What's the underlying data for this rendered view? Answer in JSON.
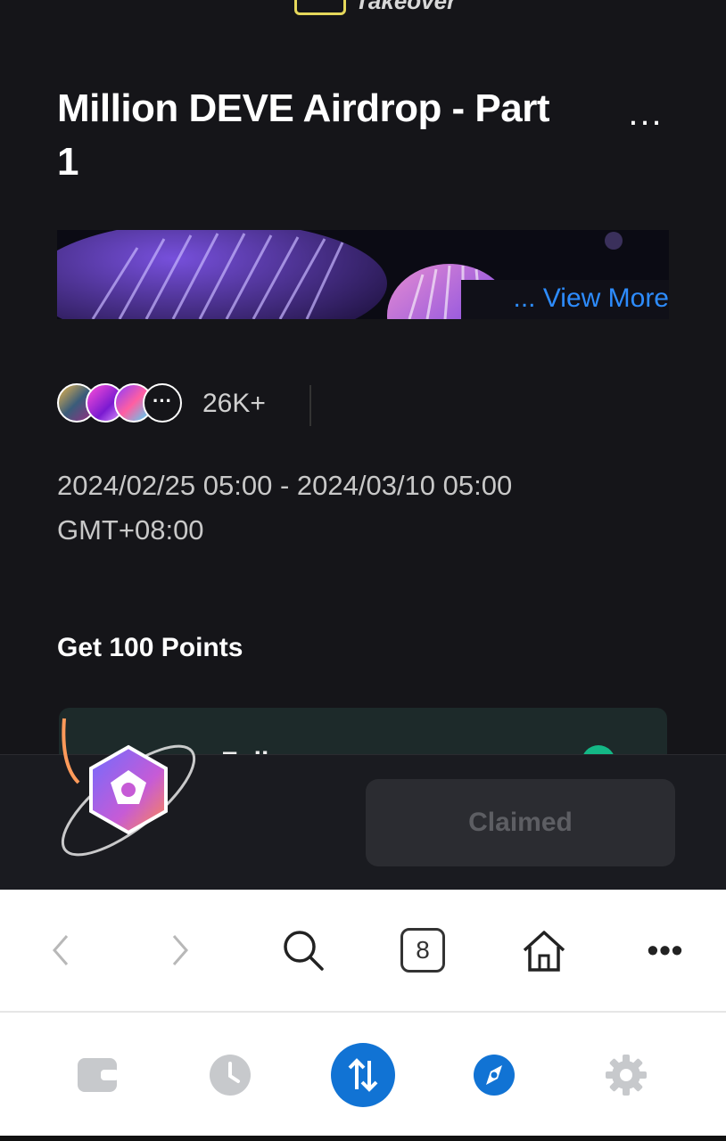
{
  "header": {
    "logo_text": "Takeover"
  },
  "campaign": {
    "title": "Million DEVE Airdrop - Part 1",
    "more_label": "...",
    "view_more": "... View More",
    "participants": "26K+",
    "avatar_more": "···",
    "date_range": "2024/02/25 05:00 - 2024/03/10 05:00",
    "timezone": "GMT+08:00"
  },
  "task_section": {
    "heading": "Get 100 Points",
    "task_label": "Foll"
  },
  "claim": {
    "button_label": "Claimed"
  },
  "browser_toolbar": {
    "tab_count": "8",
    "icons": [
      "back-icon",
      "forward-icon",
      "search-icon",
      "tabs-icon",
      "home-icon",
      "more-icon"
    ],
    "more_label": "•••"
  },
  "bottom_nav": {
    "icons": [
      "wallet-icon",
      "history-icon",
      "swap-icon",
      "discover-icon",
      "settings-icon"
    ],
    "active_color": "#1173d4",
    "inactive_color": "#c7c9cc"
  },
  "colors": {
    "accent": "#2d8cff",
    "background": "#151519",
    "success": "#14b886"
  }
}
